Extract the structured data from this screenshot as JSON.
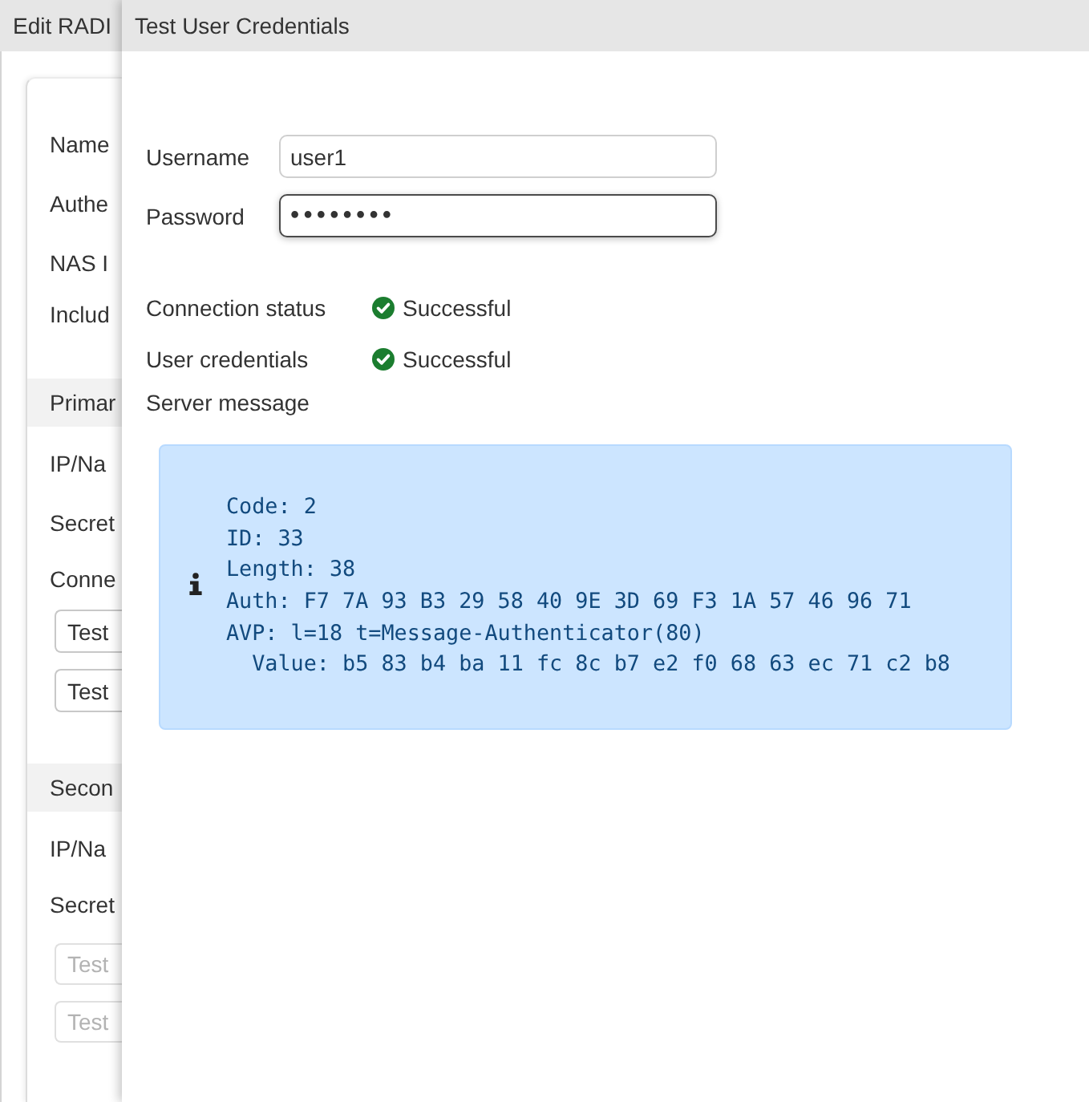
{
  "background_dialog": {
    "title": "Edit RADI",
    "fields": [
      "Name",
      "Authe",
      "NAS I",
      "Includ"
    ],
    "sections": [
      {
        "header": "Primar",
        "fields": [
          "IP/Na",
          "Secret",
          "Conne"
        ],
        "buttons": [
          {
            "label": "Test",
            "disabled": false
          },
          {
            "label": "Test",
            "disabled": false
          }
        ]
      },
      {
        "header": "Secon",
        "fields": [
          "IP/Na",
          "Secret"
        ],
        "buttons": [
          {
            "label": "Test",
            "disabled": true
          },
          {
            "label": "Test",
            "disabled": true
          }
        ]
      }
    ]
  },
  "dialog": {
    "title": "Test User Credentials",
    "fields": [
      {
        "label": "Username",
        "kind": "text",
        "value": "user1",
        "focused": false
      },
      {
        "label": "Password",
        "kind": "password",
        "value": "••••••••",
        "focused": true
      }
    ],
    "results": [
      {
        "label": "Connection status",
        "success": true,
        "value": "Successful"
      },
      {
        "label": "User credentials",
        "success": true,
        "value": "Successful"
      }
    ],
    "server_message": {
      "label": "Server message",
      "lines": [
        "Code: 2",
        "ID: 33",
        "Length: 38",
        "Auth: F7 7A 93 B3 29 58 40 9E 3D 69 F3 1A 57 46 96 71",
        "AVP: l=18 t=Message-Authenticator(80)",
        "  Value: b5 83 b4 ba 11 fc 8c b7 e2 f0 68 63 ec 71 c2 b8"
      ]
    }
  }
}
